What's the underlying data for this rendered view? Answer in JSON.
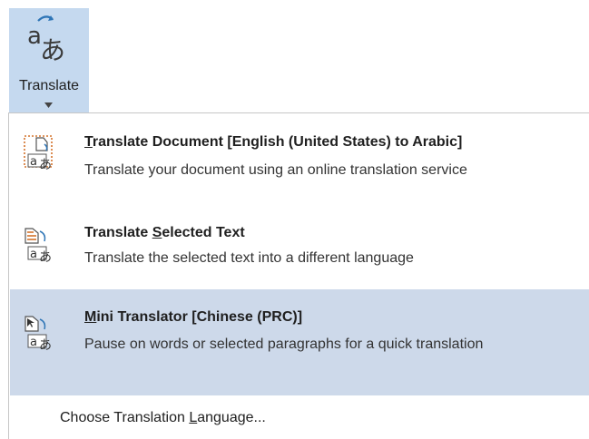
{
  "ribbon": {
    "translate_button": {
      "label": "Translate",
      "icon": "translate-icon"
    }
  },
  "menu": {
    "items": [
      {
        "title_mnemonic": "T",
        "title_rest": "ranslate Document [English (United States) to Arabic]",
        "description": "Translate your document using an online translation service",
        "icon": "translate-document-icon"
      },
      {
        "title_pre": "Translate ",
        "title_mnemonic": "S",
        "title_rest": "elected Text",
        "description": "Translate the selected text into a different language",
        "icon": "translate-selected-text-icon"
      },
      {
        "title_mnemonic": "M",
        "title_rest": "ini Translator [Chinese (PRC)]",
        "description": "Pause on words or selected paragraphs for a quick translation",
        "icon": "mini-translator-icon",
        "highlighted": true
      }
    ],
    "footer": {
      "pre": "Choose Translation ",
      "mnemonic": "L",
      "rest": "anguage..."
    }
  },
  "colors": {
    "button_active": "#c5d9ef",
    "item_highlight": "#cdd9ea",
    "icon_accent": "#d4732c",
    "icon_blue": "#2e75b6"
  }
}
